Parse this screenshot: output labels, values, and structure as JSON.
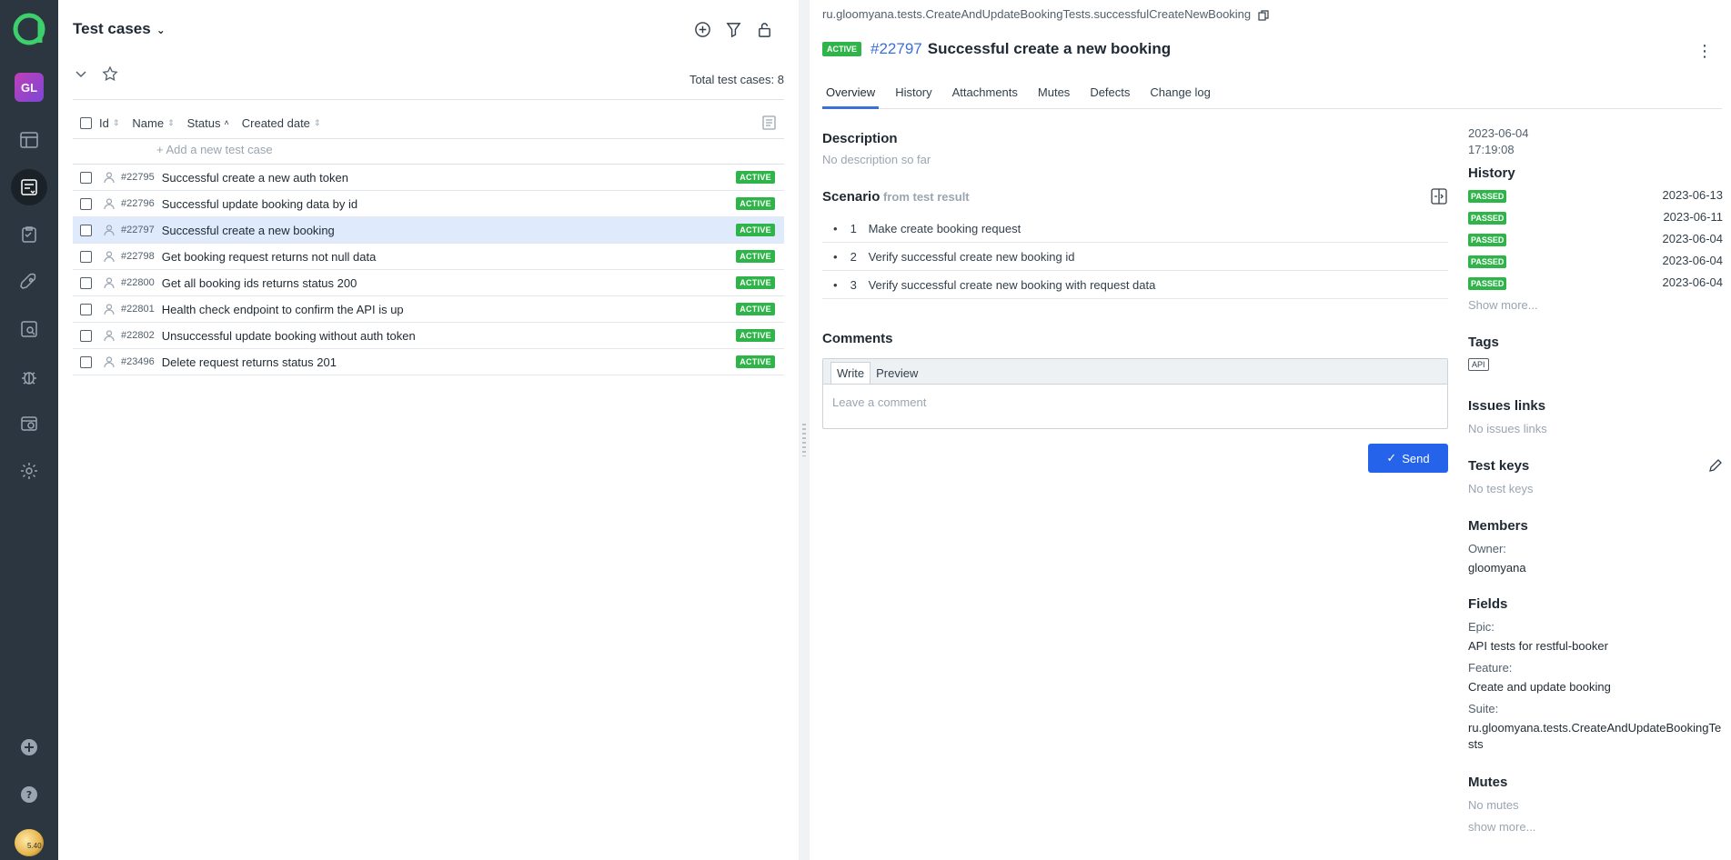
{
  "list": {
    "title": "Test cases",
    "total_label": "Total test cases: 8",
    "add_placeholder": "+  Add a new test case",
    "columns": [
      "Id",
      "Name",
      "Status",
      "Created date"
    ],
    "rows": [
      {
        "id": "#22795",
        "name": "Successful create a new auth token",
        "status": "ACTIVE"
      },
      {
        "id": "#22796",
        "name": "Successful update booking data by id",
        "status": "ACTIVE"
      },
      {
        "id": "#22797",
        "name": "Successful create a new booking",
        "status": "ACTIVE"
      },
      {
        "id": "#22798",
        "name": "Get booking request returns not null data",
        "status": "ACTIVE"
      },
      {
        "id": "#22800",
        "name": "Get all booking ids returns status 200",
        "status": "ACTIVE"
      },
      {
        "id": "#22801",
        "name": "Health check endpoint to confirm the API is up",
        "status": "ACTIVE"
      },
      {
        "id": "#22802",
        "name": "Unsuccessful update booking without auth token",
        "status": "ACTIVE"
      },
      {
        "id": "#23496",
        "name": "Delete request returns status 201",
        "status": "ACTIVE"
      }
    ]
  },
  "rail": {
    "avatar_initials": "GL",
    "version": "5.40"
  },
  "detail": {
    "full_name": "ru.gloomyana.tests.CreateAndUpdateBookingTests.successfulCreateNewBooking",
    "status": "ACTIVE",
    "id": "#22797",
    "name": "Successful create a new booking",
    "tabs": [
      "Overview",
      "History",
      "Attachments",
      "Mutes",
      "Defects",
      "Change log"
    ],
    "description_title": "Description",
    "description_empty": "No description so far",
    "scenario_title": "Scenario",
    "scenario_from": "from test result",
    "steps": [
      {
        "num": "1",
        "text": "Make create booking request"
      },
      {
        "num": "2",
        "text": "Verify successful create new booking id"
      },
      {
        "num": "3",
        "text": "Verify successful create new booking with request data"
      }
    ],
    "comments_title": "Comments",
    "comment_tabs": [
      "Write",
      "Preview"
    ],
    "comment_placeholder": "Leave a comment",
    "send_label": "Send"
  },
  "side": {
    "created_date": "2023-06-04",
    "created_time": "17:19:08",
    "history_title": "History",
    "history": [
      {
        "status": "PASSED",
        "date": "2023-06-13"
      },
      {
        "status": "PASSED",
        "date": "2023-06-11"
      },
      {
        "status": "PASSED",
        "date": "2023-06-04"
      },
      {
        "status": "PASSED",
        "date": "2023-06-04"
      },
      {
        "status": "PASSED",
        "date": "2023-06-04"
      }
    ],
    "show_more": "Show more...",
    "tags_title": "Tags",
    "tags": [
      "API"
    ],
    "issues_title": "Issues links",
    "issues_empty": "No issues links",
    "keys_title": "Test keys",
    "keys_empty": "No test keys",
    "members_title": "Members",
    "owner_label": "Owner:",
    "owner_value": "gloomyana",
    "fields_title": "Fields",
    "epic_label": "Epic:",
    "epic_value": "API tests for restful-booker",
    "feature_label": "Feature:",
    "feature_value": "Create and update booking",
    "suite_label": "Suite:",
    "suite_value": "ru.gloomyana.tests.CreateAndUpdateBookingTests",
    "mutes_title": "Mutes",
    "mutes_empty": "No mutes",
    "mutes_more": "show more..."
  },
  "colors": {
    "rail_bg": "#2b3640",
    "accent": "#2563eb",
    "badge_green": "#2fb44a",
    "link_blue": "#3b6fd9",
    "selected_row": "#dfeafc"
  }
}
